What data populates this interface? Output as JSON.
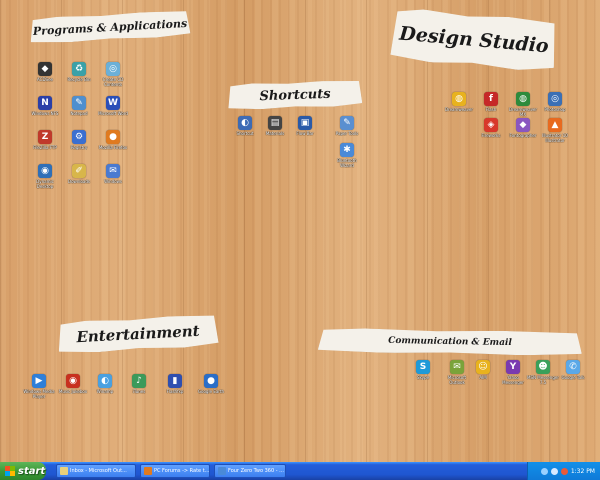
{
  "labels": {
    "programs": "Programs & Applications",
    "shortcuts": "Shortcuts",
    "design": "Design Studio",
    "entertainment": "Entertainment",
    "communication": "Communication & Email"
  },
  "programs_icons": [
    {
      "name": "acdsee-icon",
      "caption": "ACDSee",
      "color": "#333333",
      "glyph": "◆"
    },
    {
      "name": "recycle-bin-icon",
      "caption": "Recycle Bin",
      "color": "#3aa1a8",
      "glyph": "♻"
    },
    {
      "name": "create-cd-icon",
      "caption": "Create CD Contents",
      "color": "#6bb0d8",
      "glyph": "◎"
    },
    {
      "name": "nfs-icon",
      "caption": "Windows NFS",
      "color": "#2b3fa8",
      "glyph": "N"
    },
    {
      "name": "notepad-icon",
      "caption": "Notepad",
      "color": "#4f8fcf",
      "glyph": "✎"
    },
    {
      "name": "word-icon",
      "caption": "Microsoft Word",
      "color": "#2b4fb8",
      "glyph": "W"
    },
    {
      "name": "filezilla-icon",
      "caption": "FileZilla FTP",
      "color": "#c0392b",
      "glyph": "Z"
    },
    {
      "name": "registry-icon",
      "caption": "Registry",
      "color": "#3b6fd0",
      "glyph": "⚙"
    },
    {
      "name": "firefox-icon",
      "caption": "Mozilla Firefox",
      "color": "#e07a1f",
      "glyph": "●"
    },
    {
      "name": "dreamweaver-icon",
      "caption": "Dynamic Desktop",
      "color": "#2e6fb8",
      "glyph": "◉"
    },
    {
      "name": "downloads-icon",
      "caption": "Downloads",
      "color": "#d8b64a",
      "glyph": "✐"
    },
    {
      "name": "windows-icon",
      "caption": "Windows",
      "color": "#4a7ad0",
      "glyph": "✉"
    }
  ],
  "shortcuts_icons": [
    {
      "name": "shortcut-1-icon",
      "caption": "Shortcut",
      "color": "#3d6bb5",
      "glyph": "◐"
    },
    {
      "name": "shortcut-2-icon",
      "caption": "Materials",
      "color": "#444444",
      "glyph": "▤"
    },
    {
      "name": "shortcut-3-icon",
      "caption": "Flow Bar",
      "color": "#2a5aa8",
      "glyph": "▣"
    },
    {
      "name": "shortcut-4-icon",
      "caption": "Paper Tools",
      "color": "#5a8fd0",
      "glyph": "✎"
    },
    {
      "name": "shortcut-5-icon",
      "caption": "Bluetooth Wizard",
      "color": "#4a8ad8",
      "glyph": "✱"
    }
  ],
  "design_icons": [
    {
      "name": "design-1-icon",
      "caption": "Dreamweaver",
      "color": "#e8b21e",
      "glyph": "◍"
    },
    {
      "name": "design-2-icon",
      "caption": "Flash",
      "color": "#c62828",
      "glyph": "f"
    },
    {
      "name": "design-3-icon",
      "caption": "Dreamweaver MX",
      "color": "#2e8b3c",
      "glyph": "◍"
    },
    {
      "name": "design-4-icon",
      "caption": "Photoshop",
      "color": "#3a6fb5",
      "glyph": "◎"
    },
    {
      "name": "design-5-icon",
      "caption": "Fireworks",
      "color": "#d8382b",
      "glyph": "◈"
    },
    {
      "name": "design-6-icon",
      "caption": "Fontographer",
      "color": "#8a56c0",
      "glyph": "◆"
    },
    {
      "name": "design-7-icon",
      "caption": "Illustrator 10 Illustrator",
      "color": "#e86a1f",
      "glyph": "▲"
    }
  ],
  "entertainment_icons": [
    {
      "name": "ent-1-icon",
      "caption": "Windows Media Player",
      "color": "#2f7fd8",
      "glyph": "▶"
    },
    {
      "name": "ent-2-icon",
      "caption": "Music Jukebox",
      "color": "#c8301f",
      "glyph": "◉"
    },
    {
      "name": "ent-3-icon",
      "caption": "Winamp",
      "color": "#4aa0e0",
      "glyph": "◐"
    },
    {
      "name": "ent-4-icon",
      "caption": "iTunes",
      "color": "#3c9a5a",
      "glyph": "♪"
    },
    {
      "name": "ent-5-icon",
      "caption": "Flashfxp",
      "color": "#2f4fb0",
      "glyph": "▮"
    },
    {
      "name": "ent-6-icon",
      "caption": "Google Earth",
      "color": "#2a6ec8",
      "glyph": "●"
    }
  ],
  "communication_icons": [
    {
      "name": "comm-1-icon",
      "caption": "Skype",
      "color": "#1e9ad8",
      "glyph": "S"
    },
    {
      "name": "comm-2-icon",
      "caption": "Microsoft Outlook",
      "color": "#7aa33a",
      "glyph": "✉"
    },
    {
      "name": "comm-3-icon",
      "caption": "AIM",
      "color": "#e8b21e",
      "glyph": "☺"
    },
    {
      "name": "comm-4-icon",
      "caption": "Yahoo Messenger",
      "color": "#7a3ab0",
      "glyph": "Y"
    },
    {
      "name": "comm-5-icon",
      "caption": "MSN Messenger 7.5",
      "color": "#3aa05a",
      "glyph": "☻"
    },
    {
      "name": "comm-6-icon",
      "caption": "Google Talk",
      "color": "#5aa8e8",
      "glyph": "✆"
    }
  ],
  "taskbar": {
    "start_label": "start",
    "tasks": [
      {
        "name": "task-inbox",
        "label": "Inbox - Microsoft Out...",
        "color": "#e8d07a"
      },
      {
        "name": "task-pc-forums",
        "label": "PC Forums -> Rate t...",
        "color": "#e07a1f"
      },
      {
        "name": "task-four-zero",
        "label": "Four Zero Two 360 - ...",
        "color": "#4a8ad8"
      }
    ],
    "clock": "1:32 PM"
  }
}
